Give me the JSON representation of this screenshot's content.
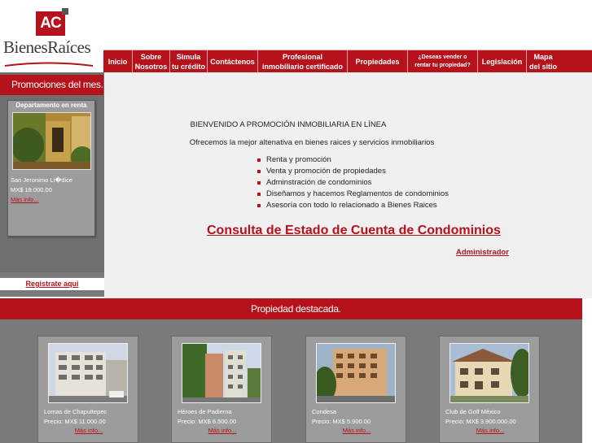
{
  "logo": {
    "mark": "AC",
    "wordmark": "BienesRaíces"
  },
  "nav": {
    "items": [
      {
        "label": "Inicio"
      },
      {
        "label": "Sobre\nNosotros"
      },
      {
        "label": "Simula\ntu crédito"
      },
      {
        "label": "Contáctenos"
      },
      {
        "label": "Profesional\ninmobiliario certificado"
      },
      {
        "label": "Propiedades"
      },
      {
        "label": "¿Deseas vender o\nrentar tu propiedad?"
      },
      {
        "label": "Legislación"
      },
      {
        "label": "Mapa\ndel sitio"
      }
    ]
  },
  "sidebar": {
    "promo_title": "Promociones del mes.",
    "promo_card": {
      "title": "Departamento en renta",
      "location": "San Jeronimo Lí�dice",
      "price": "MX$ 18.000.00",
      "more_link": "Más info..."
    },
    "register_link": "Registrate aqui"
  },
  "main": {
    "welcome": "BIENVENIDO A PROMOCIÓN INMOBILIARIA EN LÍNEA",
    "offer": "Ofrecemos la mejor altenativa en bienes raices y servicios inmobiliarios",
    "services": [
      "Renta y promoción",
      "Venta y promoción de propiedades",
      "Adminstración de condominios",
      "Diseñamos y hacemos Reglamentos de condominios",
      "Asesoría con todo lo relacionado a Bienes Raices"
    ],
    "consulta_link": "Consulta de Estado de Cuenta de Condominios",
    "admin_link": "Administrador"
  },
  "featured": {
    "title": "Propiedad destacada.",
    "properties": [
      {
        "location": "Lomas de Chapultepec",
        "price": "Precio: MX$ 11.000.00",
        "more_link": "Más info..."
      },
      {
        "location": "Héroes de Padierna",
        "price": "Precio: MX$ 6.500.00",
        "more_link": "Más info..."
      },
      {
        "location": "Condesa",
        "price": "Precio: MX$ 5.900.00",
        "more_link": "Más info..."
      },
      {
        "location": "Club de Golf México",
        "price": "Precio: MX$ 3.900.000.00",
        "more_link": "Más info..."
      }
    ]
  },
  "colors": {
    "brand_red": "#b5121b",
    "panel_gray": "#7a7a7a",
    "card_gray": "#9c9c9c"
  }
}
